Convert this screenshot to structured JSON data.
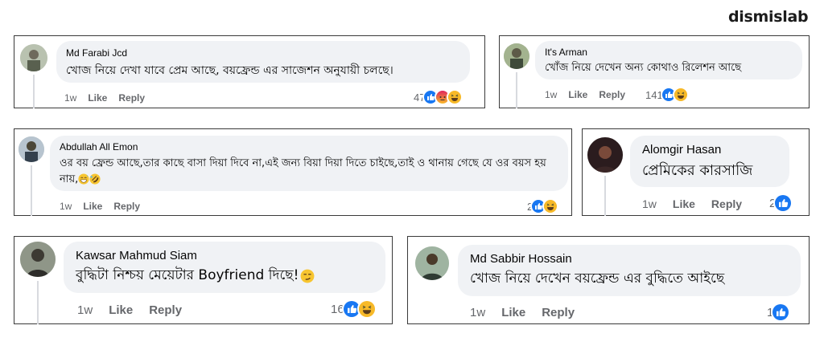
{
  "brand": "dismislab",
  "comments": [
    {
      "name": "Md Farabi Jcd",
      "text": "খোজ নিয়ে দেখা যাবে প্রেম আছে, বয়ফ্রেন্ড এর সাজেশন অনুযায়ী চলছে।",
      "time": "1w",
      "like": "Like",
      "reply": "Reply",
      "count": "47",
      "reactions": [
        "like-icon",
        "angry-icon",
        "haha-icon"
      ]
    },
    {
      "name": "It's Arman",
      "text": "খোঁজ নিয়ে দেখেন অন্য কোথাও রিলেশন আছে",
      "time": "1w",
      "like": "Like",
      "reply": "Reply",
      "count": "141",
      "reactions": [
        "like-icon",
        "haha-icon"
      ]
    },
    {
      "name": "Abdullah All Emon",
      "text": "ওর বয় ফ্রেন্ড আছে,তার কাছে বাসা দিয়া দিবে না,এই জন্য বিয়া দিয়া দিতে চাইছে,তাই ও থানায় গেছে যে ওর বয়স হয় নায়,",
      "emoji": [
        "grin-sweat-emoji",
        "rofl-emoji"
      ],
      "time": "1w",
      "like": "Like",
      "reply": "Reply",
      "count": "2",
      "reactions": [
        "like-icon",
        "haha-icon"
      ]
    },
    {
      "name": "Alomgir Hasan",
      "text": "প্রেমিকের কারসাজি",
      "time": "1w",
      "like": "Like",
      "reply": "Reply",
      "count": "2",
      "reactions": [
        "like-icon"
      ]
    },
    {
      "name": "Kawsar Mahmud Siam",
      "text": "বুদ্ধিটা নিশ্চয় মেয়েটার Boyfriend দিছে!",
      "emoji": [
        "smirk-emoji"
      ],
      "time": "1w",
      "like": "Like",
      "reply": "Reply",
      "count": "16",
      "reactions": [
        "like-icon",
        "haha-icon"
      ]
    },
    {
      "name": "Md Sabbir Hossain",
      "text": "খোজ নিয়ে দেখেন বয়ফ্রেন্ড এর বুদ্ধিতে আইছে",
      "time": "1w",
      "like": "Like",
      "reply": "Reply",
      "count": "1",
      "reactions": [
        "like-icon"
      ]
    }
  ],
  "colors": {
    "like": "#1877f2",
    "haha": "#f7b928",
    "angry": "#e9710f",
    "bubble": "#f0f2f5",
    "meta": "#65676b"
  }
}
